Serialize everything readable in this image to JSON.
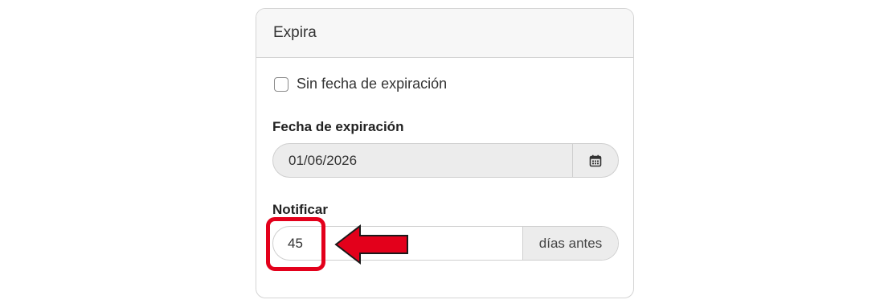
{
  "card": {
    "title": "Expira"
  },
  "no_expiry": {
    "label": "Sin fecha de expiración",
    "checked": false
  },
  "expiry_date": {
    "label": "Fecha de expiración",
    "value": "01/06/2026",
    "picker_icon": "calendar-icon"
  },
  "notify": {
    "label": "Notificar",
    "value": "45",
    "suffix": "días antes"
  },
  "annotation": {
    "highlight_color": "#e3001b",
    "arrow_color": "#e3001b",
    "arrow_icon": "arrow-left-icon"
  }
}
